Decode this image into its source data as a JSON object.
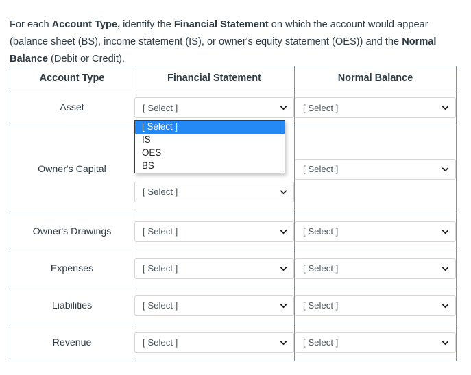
{
  "prompt": {
    "segment_1": "For each ",
    "bold_1": "Account Type,",
    "segment_2": " identify the ",
    "bold_2": "Financial Statement",
    "segment_3": " on which the account would appear (balance sheet (BS), income statement (IS), or owner's equity statement (OES)) and the ",
    "bold_3": "Normal Balance",
    "segment_4": " (Debit or Credit)."
  },
  "table": {
    "headers": {
      "account_type": "Account Type",
      "financial_statement": "Financial Statement",
      "normal_balance": "Normal Balance"
    },
    "rows": [
      {
        "account_type": "Asset",
        "financial_statement_value": "[ Select ]",
        "normal_balance_value": "[ Select ]"
      },
      {
        "account_type": "Owner's Capital",
        "financial_statement_value": "[ Select ]",
        "normal_balance_value": "[ Select ]"
      },
      {
        "account_type": "Owner's Drawings",
        "financial_statement_value": "[ Select ]",
        "normal_balance_value": "[ Select ]"
      },
      {
        "account_type": "Expenses",
        "financial_statement_value": "[ Select ]",
        "normal_balance_value": "[ Select ]"
      },
      {
        "account_type": "Liabilities",
        "financial_statement_value": "[ Select ]",
        "normal_balance_value": "[ Select ]"
      },
      {
        "account_type": "Revenue",
        "financial_statement_value": "[ Select ]",
        "normal_balance_value": "[ Select ]"
      }
    ]
  },
  "open_dropdown": {
    "belongs_to_row": "Asset",
    "belongs_to_column": "Financial Statement",
    "options": [
      {
        "label": "[ Select ]",
        "selected": true
      },
      {
        "label": "IS",
        "selected": false
      },
      {
        "label": "OES",
        "selected": false
      },
      {
        "label": "BS",
        "selected": false
      }
    ],
    "highlight_color": "#2489f4",
    "highlight_text_color": "#ffffff"
  },
  "icons": {
    "chevron_down": "chevron-down-icon"
  }
}
